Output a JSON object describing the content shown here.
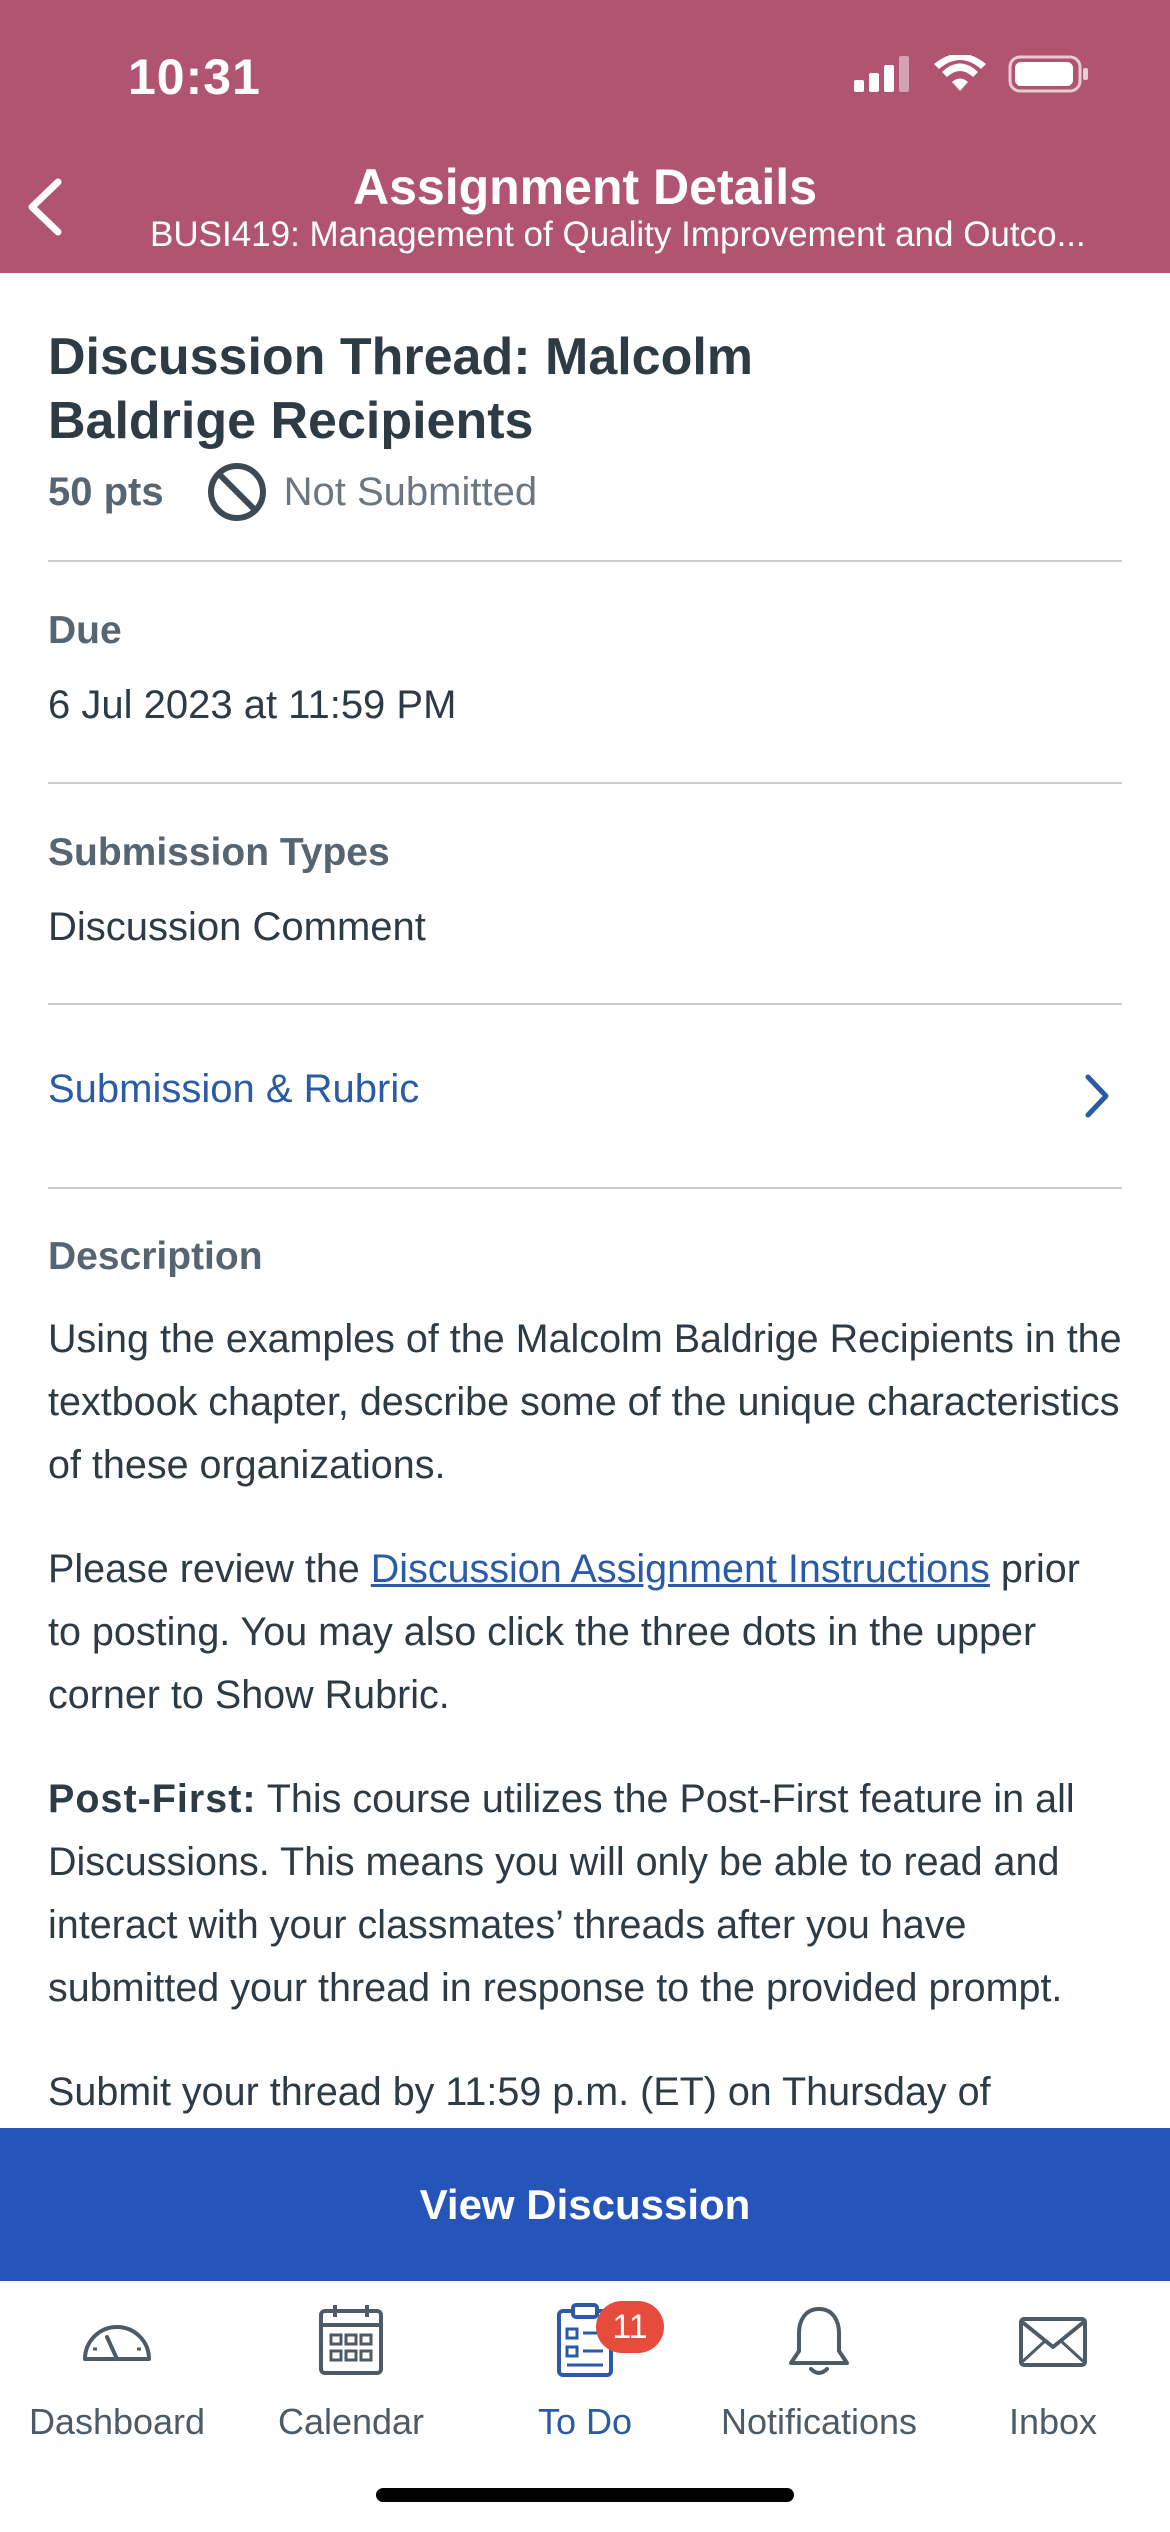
{
  "status_bar": {
    "time": "10:31"
  },
  "header": {
    "title": "Assignment Details",
    "subtitle": "BUSI419: Management of Quality Improvement and Outco..."
  },
  "assignment": {
    "title": "Discussion Thread: Malcolm Baldrige Recipients",
    "points": "50 pts",
    "status": "Not Submitted",
    "due_label": "Due",
    "due_value": "6 Jul 2023 at 11:59 PM",
    "submission_types_label": "Submission Types",
    "submission_types_value": "Discussion Comment",
    "rubric_link": "Submission & Rubric",
    "description_label": "Description",
    "description": {
      "p1": "Using the examples of the Malcolm Baldrige Recipients in the textbook chapter, describe some of the unique characteristics of these organizations.",
      "p2_before": "Please review the ",
      "p2_link": "Discussion Assignment Instructions",
      "p2_after": " prior to posting. You may also click the three dots in the upper corner to Show Rubric.",
      "p3_bold": "Post-First:",
      "p3_text": " This course utilizes the Post-First feature in all Discussions. This means you will only be able to read and interact with your classmates’ threads after you have submitted your thread in response to the provided prompt.",
      "p4": "Submit your thread by 11:59 p.m. (ET) on Thursday of"
    }
  },
  "action_button": "View Discussion",
  "tabbar": {
    "tabs": [
      {
        "label": "Dashboard",
        "icon": "dashboard-gauge-icon"
      },
      {
        "label": "Calendar",
        "icon": "calendar-icon"
      },
      {
        "label": "To Do",
        "icon": "todo-clipboard-icon",
        "badge": "11",
        "active": true
      },
      {
        "label": "Notifications",
        "icon": "bell-icon"
      },
      {
        "label": "Inbox",
        "icon": "envelope-icon"
      }
    ]
  },
  "colors": {
    "header": "#b05471",
    "link": "#2b5aa6",
    "button": "#2554bb",
    "badge": "#e64b3c"
  }
}
